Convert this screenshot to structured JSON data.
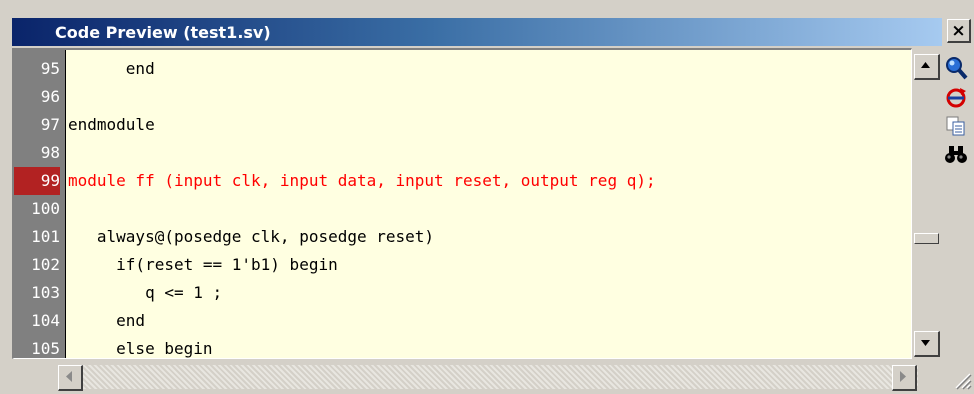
{
  "window": {
    "title": "Code Preview (test1.sv)",
    "close_label": "×"
  },
  "editor": {
    "highlight_line": 99,
    "lines": [
      {
        "num": "95",
        "text": "      end"
      },
      {
        "num": "96",
        "text": ""
      },
      {
        "num": "97",
        "text": "endmodule"
      },
      {
        "num": "98",
        "text": ""
      },
      {
        "num": "99",
        "text": "module ff (input clk, input data, input reset, output reg q);"
      },
      {
        "num": "100",
        "text": ""
      },
      {
        "num": "101",
        "text": "   always@(posedge clk, posedge reset)"
      },
      {
        "num": "102",
        "text": "     if(reset == 1'b1) begin"
      },
      {
        "num": "103",
        "text": "        q <= 1 ;"
      },
      {
        "num": "104",
        "text": "     end"
      },
      {
        "num": "105",
        "text": "     else begin"
      }
    ]
  },
  "toolbar": {
    "tools": [
      "magnifier-icon",
      "refresh-icon",
      "copy-icon",
      "binoculars-icon"
    ]
  },
  "colors": {
    "highlight": "#ff0000",
    "editor_bg": "#ffffe1",
    "gutter_bg": "#808080"
  }
}
